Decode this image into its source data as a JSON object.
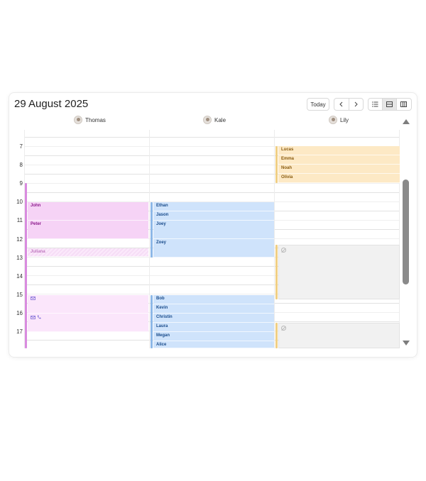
{
  "header": {
    "date_title": "29 August 2025",
    "today_label": "Today",
    "prev_icon": "chevron-left-icon",
    "next_icon": "chevron-right-icon",
    "view_buttons": [
      {
        "icon": "list-view-icon",
        "active": false
      },
      {
        "icon": "day-view-icon",
        "active": true
      },
      {
        "icon": "week-columns-icon",
        "active": false
      }
    ]
  },
  "resources": [
    {
      "name": "Thomas",
      "avatar": "avatar-icon"
    },
    {
      "name": "Kale",
      "avatar": "avatar-icon"
    },
    {
      "name": "Lily",
      "avatar": "avatar-icon"
    }
  ],
  "hours": [
    "7",
    "8",
    "9",
    "10",
    "11",
    "12",
    "13",
    "14",
    "15",
    "16",
    "17"
  ],
  "events": {
    "thomas": [
      {
        "label": "John",
        "style": "pink"
      },
      {
        "label": "Peter",
        "style": "pink"
      },
      {
        "label": "Juliana",
        "style": "hatched"
      },
      {
        "label": "",
        "style": "pinklight",
        "icons": [
          "email-icon"
        ]
      },
      {
        "label": "",
        "style": "pinklight",
        "icons": [
          "email-icon",
          "phone-icon"
        ]
      }
    ],
    "kale": [
      {
        "label": "Ethan",
        "style": "blue"
      },
      {
        "label": "Jason",
        "style": "blue"
      },
      {
        "label": "Joey",
        "style": "blue"
      },
      {
        "label": "Zoey",
        "style": "blue"
      },
      {
        "label": "Bob",
        "style": "blue"
      },
      {
        "label": "Kevin",
        "style": "blue"
      },
      {
        "label": "Christin",
        "style": "blue"
      },
      {
        "label": "Laura",
        "style": "blue"
      },
      {
        "label": "Megan",
        "style": "blue"
      },
      {
        "label": "Alice",
        "style": "blue"
      }
    ],
    "lily": [
      {
        "label": "Lucas",
        "style": "orange"
      },
      {
        "label": "Emma",
        "style": "orange"
      },
      {
        "label": "Noah",
        "style": "orange"
      },
      {
        "label": "Olivia",
        "style": "orange"
      },
      {
        "label": "",
        "style": "gray",
        "icons": [
          "blocked-icon"
        ]
      },
      {
        "label": "",
        "style": "gray",
        "icons": [
          "blocked-icon"
        ]
      }
    ]
  },
  "colors": {
    "thomas_accent": "#d98bdf",
    "kale_accent": "#8db8e8",
    "lily_accent": "#f0cf84"
  }
}
